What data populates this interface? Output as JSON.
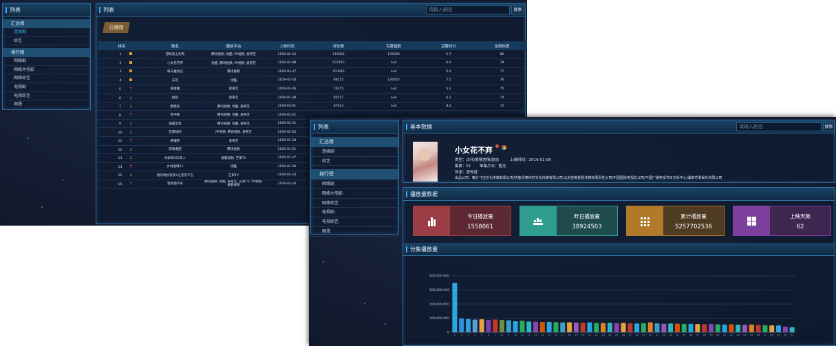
{
  "back": {
    "sidebar": {
      "title": "列表",
      "groups": [
        {
          "label": "汇总榜",
          "items": [
            "连续剧",
            "综艺"
          ]
        },
        {
          "label": "排行榜",
          "items": [
            "网络剧",
            "网络大电影",
            "网络综艺",
            "电视剧",
            "电视综艺",
            "国漫"
          ]
        }
      ]
    },
    "main": {
      "title": "列表",
      "search_placeholder": "请输入剧名",
      "search_button": "搜索",
      "tab": "日播榜",
      "columns": [
        "排名",
        "剧名",
        "播放平台",
        "上映时间",
        "评论数",
        "百度指数",
        "豆瓣评分",
        "全网热度"
      ],
      "rows": [
        {
          "rank": "1",
          "trend": "same",
          "name": "游戏海上的奇",
          "platform": "腾讯视频, 优酷, PP视频, 爱奇艺",
          "date": "2019-02-12",
          "comments": "115092",
          "baidu": "135096",
          "douban": "5.7",
          "heat": "86"
        },
        {
          "rank": "2",
          "trend": "same",
          "name": "小女花不弃",
          "platform": "优酷, 腾讯视频, PP视频, 爱奇艺",
          "date": "2019-01-08",
          "comments": "537412",
          "baidu": "null",
          "douban": "6.0",
          "heat": "78"
        },
        {
          "rank": "3",
          "trend": "same",
          "name": "倚天屠龙记",
          "platform": "腾讯视频",
          "date": "2019-02-27",
          "comments": "103545",
          "baidu": "null",
          "douban": "5.0",
          "heat": "77"
        },
        {
          "rank": "4",
          "trend": "same",
          "name": "东宫",
          "platform": "优酷",
          "date": "2019-02-14",
          "comments": "88555",
          "baidu": "126025",
          "douban": "7.5",
          "heat": "76"
        },
        {
          "rank": "5",
          "trend": "up",
          "name": "黄金瞳",
          "platform": "爱奇艺",
          "date": "2019-02-26",
          "comments": "70275",
          "baidu": "null",
          "douban": "5.3",
          "heat": "75"
        },
        {
          "rank": "6",
          "trend": "down",
          "name": "招摇",
          "platform": "爱奇艺",
          "date": "2019-01-28",
          "comments": "85527",
          "baidu": "null",
          "douban": "6.2",
          "heat": "74"
        },
        {
          "rank": "7",
          "trend": "down",
          "name": "都挺好",
          "platform": "腾讯视频, 优酷, 爱奇艺",
          "date": "2019-03-01",
          "comments": "67643",
          "baidu": "null",
          "douban": "8.4",
          "heat": "72"
        },
        {
          "rank": "8",
          "trend": "up",
          "name": "老中医",
          "platform": "腾讯视频, 优酷, 爱奇艺",
          "date": "2019-02-21",
          "comments": "",
          "baidu": "",
          "douban": "",
          "heat": ""
        },
        {
          "rank": "9",
          "trend": "down",
          "name": "独孤皇后",
          "platform": "腾讯视频, 优酷, 爱奇艺",
          "date": "2019-02-11",
          "comments": "",
          "baidu": "",
          "douban": "",
          "heat": ""
        },
        {
          "rank": "10",
          "trend": "down",
          "name": "芝麻胡同",
          "platform": "PP视频, 腾讯视频, 爱奇艺",
          "date": "2019-02-22",
          "comments": "",
          "baidu": "",
          "douban": "",
          "heat": ""
        },
        {
          "rank": "11",
          "trend": "up",
          "name": "皓镧传",
          "platform": "爱奇艺",
          "date": "2019-01-19",
          "comments": "",
          "baidu": "",
          "douban": "",
          "heat": ""
        },
        {
          "rank": "12",
          "trend": "down",
          "name": "怒晴湘西",
          "platform": "腾讯视频",
          "date": "2019-01-21",
          "comments": "",
          "baidu": "",
          "douban": "",
          "heat": ""
        },
        {
          "rank": "13",
          "trend": "down",
          "name": "你好BOSS夫人",
          "platform": "搜狐视频, 芒果TV",
          "date": "2019-01-17",
          "comments": "",
          "baidu": "",
          "douban": "",
          "heat": ""
        },
        {
          "rank": "14",
          "trend": "up",
          "name": "乡村爱情11",
          "platform": "优酷",
          "date": "2019-01-26",
          "comments": "",
          "baidu": "",
          "douban": "",
          "heat": ""
        },
        {
          "rank": "15",
          "trend": "down",
          "name": "我的奇妙男友2之恋恋不忘",
          "platform": "芒果TV",
          "date": "2019-02-14",
          "comments": "",
          "baidu": "",
          "douban": "",
          "heat": ""
        },
        {
          "rank": "16",
          "trend": "up",
          "name": "雪地狼子军",
          "platform": "腾讯视频, 优酷, 爱奇艺, 芒果TV, PP视频, 搜狐视频",
          "date": "2019-02-10",
          "comments": "",
          "baidu": "",
          "douban": "",
          "heat": ""
        }
      ]
    }
  },
  "front": {
    "sidebar": {
      "title": "列表",
      "groups": [
        {
          "label": "汇总榜",
          "items": [
            "连续剧",
            "综艺"
          ]
        },
        {
          "label": "排行榜",
          "items": [
            "网络剧",
            "网络大电影",
            "网络综艺",
            "电视剧",
            "电视综艺",
            "国漫"
          ]
        }
      ]
    },
    "basic": {
      "title": "基本数据",
      "search_placeholder": "请输入剧名",
      "search_button": "搜索",
      "show_title": "小女花不弃",
      "type_line": "类型：古代/爱情言情/励志",
      "release_line": "上映时间：2019-01-08",
      "episodes_line": "集数：51",
      "length_line": "单集片长：暂无",
      "director_line": "导演：查传谊",
      "company_line": "出品公司：喀什飞宝文化传媒有限公司/拼客青春你好文化传媒有限公司/北京完美影视传媒有限责任公司/中国国际电视总公司/中国广播电视节目交易中心/湖南芒果娱乐有限公司"
    },
    "playback": {
      "title": "播放量数据",
      "cards": [
        {
          "label": "今日播放量",
          "value": "1558061",
          "icon": "bar-chart-icon",
          "color": "#9b3d45"
        },
        {
          "label": "昨日播放量",
          "value": "38924503",
          "icon": "stacked-bars-icon",
          "color": "#2f9e8f"
        },
        {
          "label": "累计播放量",
          "value": "5257702536",
          "icon": "grid-icon",
          "color": "#b07a2a"
        },
        {
          "label": "上映天数",
          "value": "62",
          "icon": "windows-icon",
          "color": "#7c3f9e"
        }
      ]
    },
    "episodes": {
      "title": "分集播放量"
    }
  },
  "chart_data": {
    "type": "bar",
    "title": "分集播放量",
    "ylim": [
      0,
      400000000
    ],
    "yticks": [
      "400,000,000",
      "300,000,000",
      "200,000,000",
      "100,000,000",
      "0"
    ],
    "ytick_values": [
      400000000,
      300000000,
      200000000,
      100000000,
      0
    ],
    "categories": [
      "1",
      "2",
      "3",
      "4",
      "5",
      "6",
      "7",
      "8",
      "9",
      "10",
      "11",
      "12",
      "13",
      "14",
      "15",
      "16",
      "17",
      "18",
      "19",
      "20",
      "21",
      "22",
      "23",
      "24",
      "25",
      "26",
      "27",
      "28",
      "29",
      "30",
      "31",
      "32",
      "33",
      "34",
      "35",
      "36",
      "37",
      "38",
      "39",
      "40",
      "41",
      "42",
      "43",
      "44",
      "45",
      "46",
      "47",
      "48",
      "49",
      "50",
      "51"
    ],
    "values": [
      350000000,
      98000000,
      93000000,
      90000000,
      92000000,
      88000000,
      90000000,
      87000000,
      85000000,
      78000000,
      82000000,
      76000000,
      75000000,
      73000000,
      74000000,
      72000000,
      70000000,
      71000000,
      69000000,
      68000000,
      70000000,
      66000000,
      65000000,
      67000000,
      64000000,
      66000000,
      63000000,
      62000000,
      64000000,
      70000000,
      63000000,
      60000000,
      62000000,
      61000000,
      59000000,
      60000000,
      58000000,
      57000000,
      59000000,
      56000000,
      55000000,
      57000000,
      54000000,
      53000000,
      55000000,
      52000000,
      50000000,
      49000000,
      48000000,
      40000000,
      36000000
    ],
    "colors": [
      "#2aa7e0",
      "#2d8fd8",
      "#2f9fd9",
      "#5aa0d8",
      "#e6a23c",
      "#7b3fb5",
      "#c0392b",
      "#6f8f3f",
      "#3aa0c8",
      "#2aa7e0",
      "#27ae60",
      "#2fb5c0",
      "#8e44ad",
      "#d35400",
      "#2aa7e0",
      "#27ae60",
      "#3aa0c8",
      "#e6a23c",
      "#9b59b6",
      "#c0392b",
      "#2aa7e0",
      "#27ae60",
      "#e67e22",
      "#2fb5c0",
      "#8e44ad",
      "#e6a23c",
      "#c0392b",
      "#2aa7e0",
      "#27ae60",
      "#e67e22",
      "#3aa0c8",
      "#9b59b6",
      "#2fb5c0",
      "#d35400",
      "#27ae60",
      "#2aa7e0",
      "#e6a23c",
      "#c0392b",
      "#8e44ad",
      "#27ae60",
      "#2aa7e0",
      "#d35400",
      "#2fb5c0",
      "#9b59b6",
      "#e67e22",
      "#c0392b",
      "#27ae60",
      "#e6a23c",
      "#2aa7e0",
      "#8e44ad",
      "#2fb5c0"
    ],
    "grid": true,
    "legend": "none"
  }
}
